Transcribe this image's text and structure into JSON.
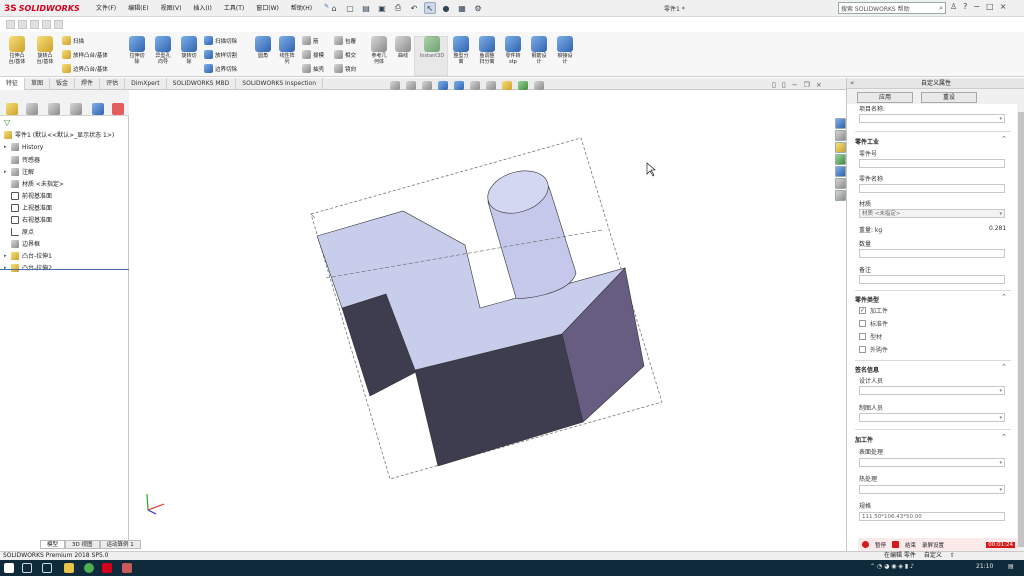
{
  "app": {
    "logo_ds": "3S",
    "logo_name": "SOLIDWORKS",
    "document_title": "零件1 *",
    "menus": [
      "文件(F)",
      "编辑(E)",
      "视图(V)",
      "插入(I)",
      "工具(T)",
      "窗口(W)",
      "帮助(H)"
    ],
    "search_placeholder": "搜索 SOLIDWORKS 帮助",
    "window_controls": [
      "?",
      "−",
      "□",
      "×"
    ]
  },
  "ribbon": {
    "buttons": [
      {
        "label": "拉伸凸\n台/基体",
        "icon": "extrude-boss-icon"
      },
      {
        "label": "旋转凸\n台/基体",
        "icon": "revolve-boss-icon"
      },
      {
        "label": "拉伸切\n除",
        "icon": "extrude-cut-icon"
      },
      {
        "label": "异型孔\n向导",
        "icon": "hole-wizard-icon"
      },
      {
        "label": "旋转切\n除",
        "icon": "revolve-cut-icon"
      },
      {
        "label": "圆角",
        "icon": "fillet-icon"
      },
      {
        "label": "线性阵\n列",
        "icon": "linear-pattern-icon"
      },
      {
        "label": "参考几\n何体",
        "icon": "reference-geometry-icon"
      },
      {
        "label": "曲线",
        "icon": "curves-icon"
      },
      {
        "label": "Instant3D",
        "icon": "instant3d-icon"
      },
      {
        "label": "整型分\n离",
        "icon": "split-icon"
      },
      {
        "label": "鱼调整\n扫分离",
        "icon": "adjust-icon"
      },
      {
        "label": "零件转\nstp",
        "icon": "convert-stp-icon"
      },
      {
        "label": "钢筋设\n计",
        "icon": "rebar-icon"
      },
      {
        "label": "铆接设\n计",
        "icon": "rivet-icon"
      }
    ],
    "small_items": [
      "扫描",
      "放样凸台/基体",
      "边界凸台/基体",
      "扫描切除",
      "放样切割",
      "边界切除",
      "筋",
      "拔模",
      "抽壳",
      "包覆",
      "相交",
      "镜向"
    ]
  },
  "tabs": [
    "特征",
    "草图",
    "钣金",
    "焊件",
    "评估",
    "DimXpert",
    "SOLIDWORKS MBD",
    "SOLIDWORKS Inspection"
  ],
  "tabs_active": 0,
  "feature_tree": {
    "root": "零件1  (默认<<默认>_显示状态 1>)",
    "items": [
      {
        "label": "History",
        "arrow": "▸",
        "icon": "history-icon"
      },
      {
        "label": "传感器",
        "arrow": "",
        "icon": "sensors-icon"
      },
      {
        "label": "注解",
        "arrow": "▸",
        "icon": "annotations-icon"
      },
      {
        "label": "材质 <未指定>",
        "arrow": "",
        "icon": "material-icon"
      },
      {
        "label": "前视基准面",
        "arrow": "",
        "icon": "plane-icon"
      },
      {
        "label": "上视基准面",
        "arrow": "",
        "icon": "plane-icon"
      },
      {
        "label": "右视基准面",
        "arrow": "",
        "icon": "plane-icon"
      },
      {
        "label": "原点",
        "arrow": "",
        "icon": "origin-icon"
      },
      {
        "label": "边界框",
        "arrow": "",
        "icon": "bounding-box-icon"
      },
      {
        "label": "凸台-拉伸1",
        "arrow": "▸",
        "icon": "boss-extrude-icon"
      },
      {
        "label": "凸台-拉伸2",
        "arrow": "▸",
        "icon": "boss-extrude-icon"
      }
    ]
  },
  "property_panel": {
    "title": "自定义属性",
    "apply": "应用",
    "reset": "重设",
    "top_label": "项目名称:",
    "section_part": "零件工业",
    "part_number_label": "零件号",
    "part_name_label": "零件名称",
    "material_label": "材质",
    "material_value": "材质 <未指定>",
    "mass_label": "重量: kg",
    "mass_value": "0.281",
    "quantity_label": "数量",
    "remark_label": "备注",
    "section_type": "零件类型",
    "types": [
      {
        "label": "加工件",
        "checked": true
      },
      {
        "label": "标准件",
        "checked": false
      },
      {
        "label": "型材",
        "checked": false
      },
      {
        "label": "外购件",
        "checked": false
      }
    ],
    "section_sign": "签名信息",
    "designer_label": "设计人员",
    "drafter_label": "制图人员",
    "section_process": "加工件",
    "surface_label": "表面处理",
    "heat_label": "热处理",
    "spec_label": "规格",
    "spec_value": "111.50*106.43*50.00"
  },
  "recorder": {
    "pause": "暂停",
    "end": "结束",
    "options": "录屏设置",
    "time": "00:01:24"
  },
  "bottom_tabs": [
    "模型",
    "3D 视图",
    "运动算例 1"
  ],
  "status": {
    "left": "SOLIDWORKS Premium 2018 SP5.0",
    "right": [
      "在编辑 零件",
      "自定义",
      "⇧"
    ]
  },
  "taskbar": {
    "time": "21:10"
  },
  "colors": {
    "brand_red": "#d6001c",
    "face_top": "#c9cdec",
    "face_dark": "#3e3d4f",
    "face_side": "#675d80",
    "taskbar": "#0f2a3a"
  }
}
